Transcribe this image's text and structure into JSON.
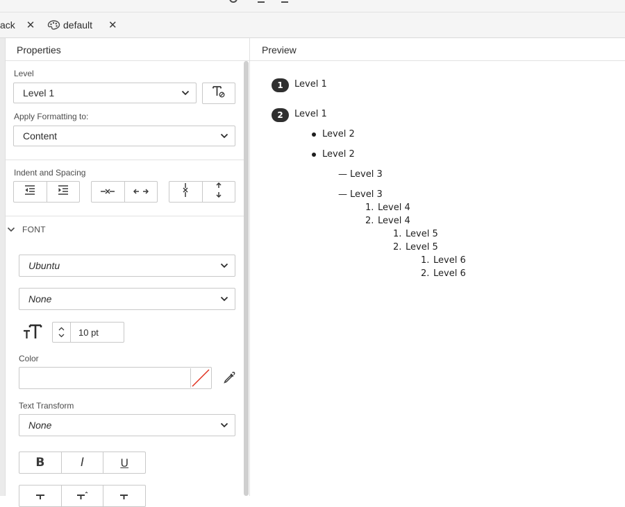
{
  "tabs": [
    {
      "label": "ack",
      "close": "✕"
    },
    {
      "label": "default",
      "close": "✕"
    }
  ],
  "properties_panel": {
    "title": "Properties",
    "level": {
      "label": "Level",
      "value": "Level 1"
    },
    "apply_formatting": {
      "label": "Apply Formatting to:",
      "value": "Content"
    },
    "indent_spacing": {
      "label": "Indent and Spacing"
    },
    "font_section": {
      "label": "FONT",
      "family": "Ubuntu",
      "style": "None",
      "size": "10 pt",
      "color_label": "Color",
      "text_transform_label": "Text Transform",
      "text_transform_value": "None",
      "bold": "B",
      "italic": "I",
      "underline": "U"
    }
  },
  "preview": {
    "title": "Preview",
    "items": [
      {
        "marker": "1",
        "text": "Level 1"
      },
      {
        "marker": "2",
        "text": "Level 1"
      },
      {
        "marker": "•",
        "text": "Level 2"
      },
      {
        "marker": "•",
        "text": "Level 2"
      },
      {
        "marker": "—",
        "text": "Level 3"
      },
      {
        "marker": "—",
        "text": "Level 3"
      },
      {
        "marker": "1.",
        "text": "Level 4"
      },
      {
        "marker": "2.",
        "text": "Level 4"
      },
      {
        "marker": "1.",
        "text": "Level 5"
      },
      {
        "marker": "2.",
        "text": "Level 5"
      },
      {
        "marker": "1.",
        "text": "Level 6"
      },
      {
        "marker": "2.",
        "text": "Level 6"
      }
    ]
  },
  "colors": {
    "accent_badge": "#2f2f2f",
    "color_swatch_slash": "#e0301e"
  }
}
